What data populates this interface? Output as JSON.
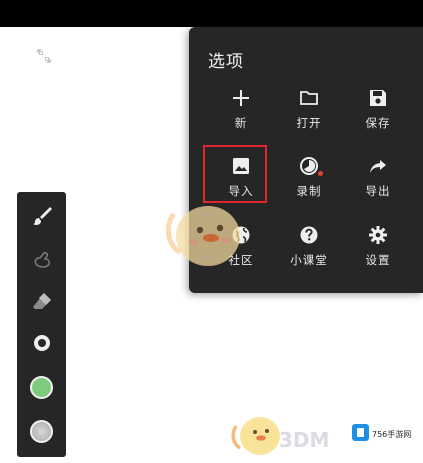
{
  "menu": {
    "title": "选项",
    "items": [
      {
        "label": "新",
        "icon": "plus-icon"
      },
      {
        "label": "打开",
        "icon": "folder-icon"
      },
      {
        "label": "保存",
        "icon": "save-icon"
      },
      {
        "label": "导入",
        "icon": "image-icon"
      },
      {
        "label": "录制",
        "icon": "timer-icon"
      },
      {
        "label": "导出",
        "icon": "share-icon"
      },
      {
        "label": "社区",
        "icon": "globe-icon"
      },
      {
        "label": "小课堂",
        "icon": "help-icon"
      },
      {
        "label": "设置",
        "icon": "gear-icon"
      }
    ],
    "highlighted_item": "导入"
  },
  "toolbar": {
    "tools": [
      "brush-icon",
      "smudge-icon",
      "eraser-icon",
      "brush-size-icon",
      "color-swatch",
      "texture-swatch"
    ],
    "color": "#7ecb7c"
  },
  "colors": {
    "panel": "#262626",
    "highlight": "#e0262b",
    "record_dot": "#e0452b"
  },
  "watermark": {
    "text": "3DM",
    "logo_text": "756手游网"
  }
}
